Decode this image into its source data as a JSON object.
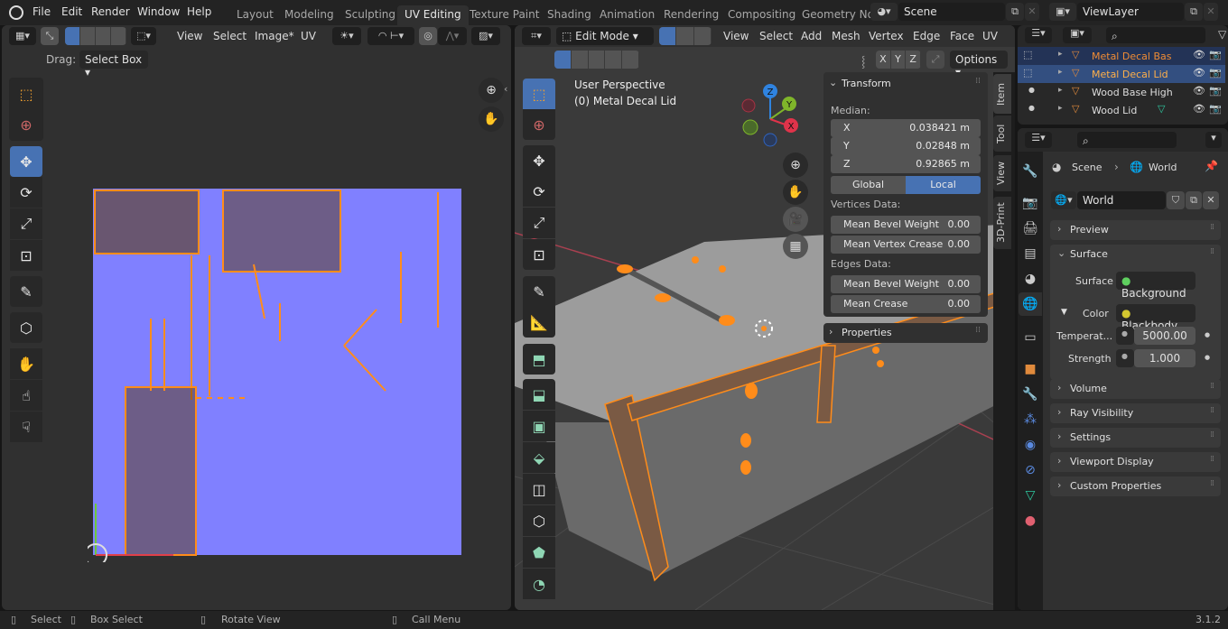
{
  "topbar": {
    "menus": [
      "File",
      "Edit",
      "Render",
      "Window",
      "Help"
    ],
    "workspaces": [
      "Layout",
      "Modeling",
      "Sculpting",
      "UV Editing",
      "Texture Paint",
      "Shading",
      "Animation",
      "Rendering",
      "Compositing",
      "Geometry No"
    ],
    "active_workspace": "UV Editing",
    "scene_name": "Scene",
    "view_layer_name": "ViewLayer"
  },
  "uv_editor": {
    "header_menus": [
      "View",
      "Select",
      "Image*",
      "UV"
    ],
    "drag_label": "Drag:",
    "drag_value": "Select Box",
    "tools": [
      "tweak",
      "cursor",
      "move",
      "rotate",
      "scale",
      "transform",
      "annotate",
      "rip",
      "grab",
      "relax",
      "pinch"
    ],
    "active_tool": "move"
  },
  "viewport": {
    "mode": "Edit Mode",
    "header_menus": [
      "View",
      "Select",
      "Add",
      "Mesh",
      "Vertex",
      "Edge",
      "Face",
      "UV"
    ],
    "axes": [
      "X",
      "Y",
      "Z"
    ],
    "options_label": "Options",
    "overlay_title": "User Perspective",
    "overlay_object": "(0) Metal Decal Lid",
    "gizmo_axes": [
      "X",
      "Y",
      "Z"
    ],
    "side_tabs": [
      "Item",
      "Tool",
      "View",
      "3D-Print"
    ],
    "active_side_tab": "Item"
  },
  "transform_panel": {
    "title": "Transform",
    "median_label": "Median:",
    "median": [
      {
        "axis": "X",
        "value": "0.038421 m"
      },
      {
        "axis": "Y",
        "value": "0.02848 m"
      },
      {
        "axis": "Z",
        "value": "0.92865 m"
      }
    ],
    "space_options": [
      "Global",
      "Local"
    ],
    "active_space": "Local",
    "vertices_label": "Vertices Data:",
    "vertices": [
      {
        "label": "Mean Bevel Weight",
        "value": "0.00"
      },
      {
        "label": "Mean Vertex Crease",
        "value": "0.00"
      }
    ],
    "edges_label": "Edges Data:",
    "edges": [
      {
        "label": "Mean Bevel Weight",
        "value": "0.00"
      },
      {
        "label": "Mean Crease",
        "value": "0.00"
      }
    ],
    "properties_label": "Properties"
  },
  "outliner": {
    "items": [
      {
        "name": "Metal Decal Bas",
        "selected": true,
        "active": false
      },
      {
        "name": "Metal Decal Lid",
        "selected": true,
        "active": true
      },
      {
        "name": "Wood Base High",
        "selected": false,
        "active": false
      },
      {
        "name": "Wood Lid",
        "selected": false,
        "active": false
      }
    ]
  },
  "properties": {
    "breadcrumb": [
      "Scene",
      "World"
    ],
    "world_name": "World",
    "panels": {
      "preview": "Preview",
      "surface": "Surface",
      "volume": "Volume",
      "ray_visibility": "Ray Visibility",
      "settings": "Settings",
      "viewport_display": "Viewport Display",
      "custom_properties": "Custom Properties"
    },
    "surface_label": "Surface",
    "surface_value": "Background",
    "color_label": "Color",
    "color_value": "Blackbody",
    "temperature_label": "Temperat...",
    "temperature_value": "5000.00",
    "strength_label": "Strength",
    "strength_value": "1.000"
  },
  "statusbar": {
    "items": [
      "Select",
      "Box Select",
      "Rotate View",
      "Call Menu"
    ],
    "version": "3.1.2"
  },
  "colors": {
    "accent": "#4772b3",
    "selection_orange": "#ff8c1a",
    "uv_texture": "#8080ff"
  }
}
